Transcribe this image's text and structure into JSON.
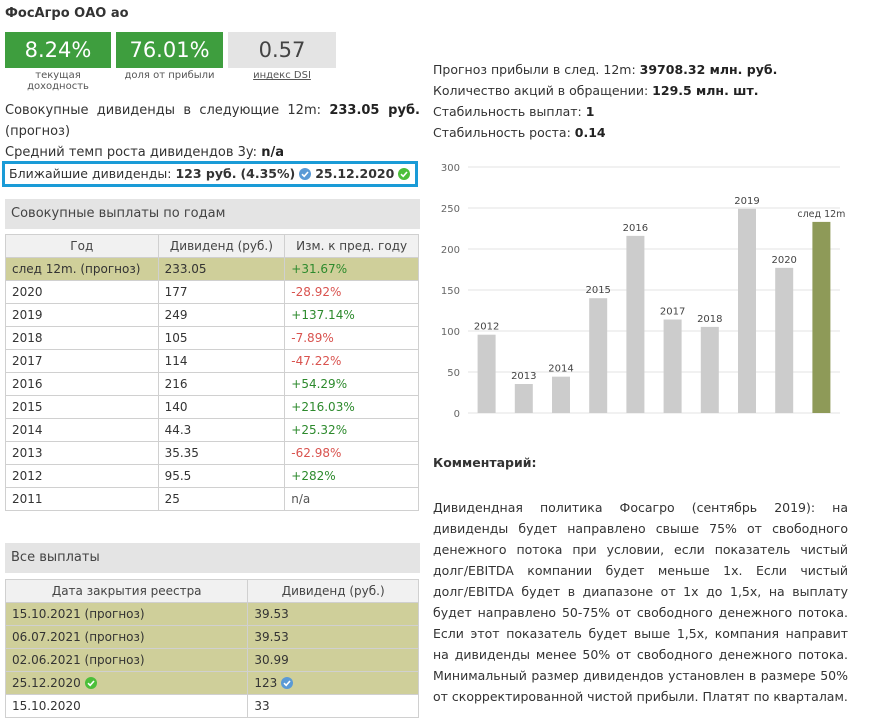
{
  "title": "ФосАгро ОАО ао",
  "tiles": [
    {
      "value": "8.24%",
      "caption": "текущая доходность",
      "color": "#3e9e3e"
    },
    {
      "value": "76.01%",
      "caption": "доля от прибыли",
      "color": "#3e9e3e"
    },
    {
      "value": "0.57",
      "caption": "индекс DSI",
      "color": "#e4e4e4"
    }
  ],
  "summary": {
    "total_div_label": "Совокупные дивиденды в следующие 12m:",
    "total_div_value": "233.05 руб.",
    "total_div_note": "(прогноз)",
    "growth_label": "Средний темп роста дивидендов 3y:",
    "growth_value": "n/a"
  },
  "nearest": {
    "label": "Ближайшие дивиденды:",
    "amount": "123 руб.",
    "yield": "(4.35%)",
    "date": "25.12.2020"
  },
  "by_year": {
    "header": "Совокупные выплаты по годам",
    "columns": [
      "Год",
      "Дивиденд (руб.)",
      "Изм. к пред. году"
    ],
    "rows": [
      {
        "year": "след 12m. (прогноз)",
        "div": "233.05",
        "chg": "+31.67%",
        "sign": "pos",
        "hl": true
      },
      {
        "year": "2020",
        "div": "177",
        "chg": "-28.92%",
        "sign": "neg"
      },
      {
        "year": "2019",
        "div": "249",
        "chg": "+137.14%",
        "sign": "pos"
      },
      {
        "year": "2018",
        "div": "105",
        "chg": "-7.89%",
        "sign": "neg"
      },
      {
        "year": "2017",
        "div": "114",
        "chg": "-47.22%",
        "sign": "neg"
      },
      {
        "year": "2016",
        "div": "216",
        "chg": "+54.29%",
        "sign": "pos"
      },
      {
        "year": "2015",
        "div": "140",
        "chg": "+216.03%",
        "sign": "pos"
      },
      {
        "year": "2014",
        "div": "44.3",
        "chg": "+25.32%",
        "sign": "pos"
      },
      {
        "year": "2013",
        "div": "35.35",
        "chg": "-62.98%",
        "sign": "neg"
      },
      {
        "year": "2012",
        "div": "95.5",
        "chg": "+282%",
        "sign": "pos"
      },
      {
        "year": "2011",
        "div": "25",
        "chg": "n/a",
        "sign": "neu"
      }
    ]
  },
  "all_payments": {
    "header": "Все выплаты",
    "columns": [
      "Дата закрытия реестра",
      "Дивиденд (руб.)"
    ],
    "rows": [
      {
        "date": "15.10.2021 (прогноз)",
        "div": "39.53",
        "hl": true
      },
      {
        "date": "06.07.2021 (прогноз)",
        "div": "39.53",
        "hl": true
      },
      {
        "date": "02.06.2021 (прогноз)",
        "div": "30.99",
        "hl": true
      },
      {
        "date": "25.12.2020",
        "div": "123",
        "hl": true,
        "date_icon": "green-check-icon",
        "div_icon": "blue-check-icon"
      },
      {
        "date": "15.10.2020",
        "div": "33",
        "hl": false
      }
    ]
  },
  "stats": {
    "forecast_label": "Прогноз прибыли в след. 12m:",
    "forecast_value": "39708.32 млн. руб.",
    "shares_label": "Количество акций в обращении:",
    "shares_value": "129.5 млн. шт.",
    "stab_pay_label": "Стабильность выплат:",
    "stab_pay_value": "1",
    "stab_growth_label": "Стабильность роста:",
    "stab_growth_value": "0.14"
  },
  "chart_data": {
    "type": "bar",
    "categories": [
      "2012",
      "2013",
      "2014",
      "2015",
      "2016",
      "2017",
      "2018",
      "2019",
      "2020",
      "след 12m"
    ],
    "values": [
      95.5,
      35.35,
      44.3,
      140,
      216,
      114,
      105,
      249,
      177,
      233.05
    ],
    "ylim": [
      0,
      300
    ],
    "yticks": [
      0,
      50,
      100,
      150,
      200,
      250,
      300
    ],
    "grid": true,
    "colors": {
      "bar": "#cccccc",
      "forecast": "#8e9a58"
    }
  },
  "comment": {
    "title": "Комментарий:",
    "text": "Дивидендная политика Фосагро (сентябрь 2019): на дивиденды будет направлено свыше 75% от свободного денежного потока при условии, если показатель чистый долг/EBITDA компании будет меньше 1х. Если чистый долг/EBITDA будет в диапазоне от 1х до 1,5х, на выплату будет направлено 50-75% от свободного денежного потока. Если этот показатель будет выше 1,5х, компания направит на дивиденды менее 50% от свободного денежного потока. Минимальный размер дивидендов установлен в размере 50% от скорректированной чистой прибыли. Платят по кварталам."
  }
}
